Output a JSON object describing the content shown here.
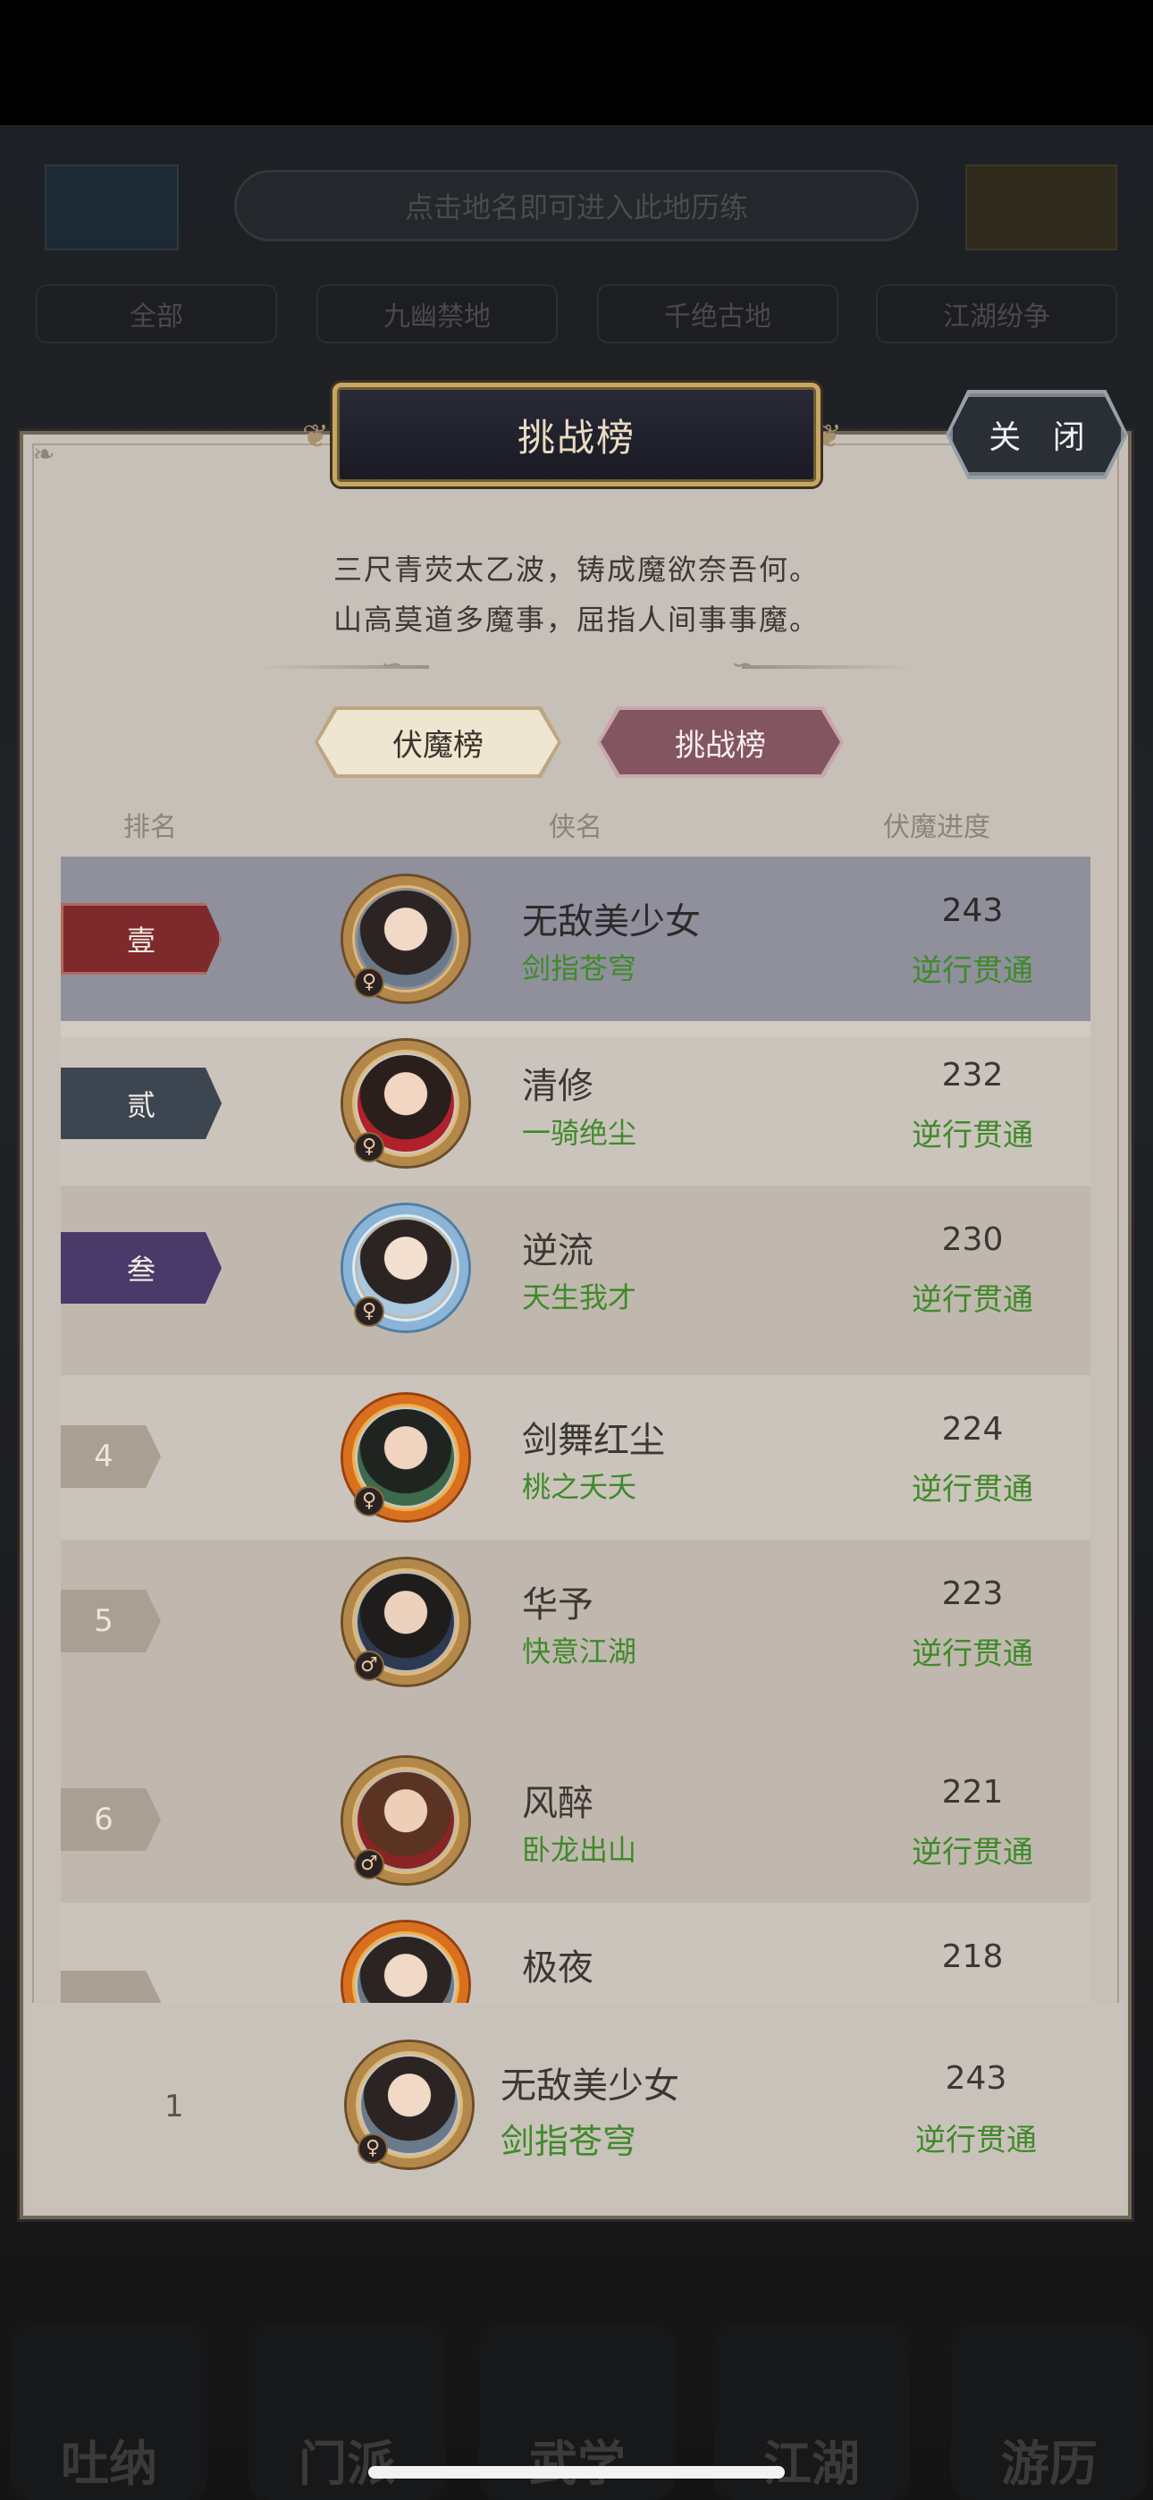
{
  "background": {
    "hint_text": "点击地名即可进入此地历练",
    "tabs": [
      "全部",
      "九幽禁地",
      "千绝古地",
      "江湖纷争"
    ],
    "nav": [
      "吐纳",
      "门派",
      "武学",
      "江湖",
      "游历"
    ]
  },
  "dialog": {
    "title": "挑战榜",
    "close_label": "关 闭",
    "poem_line1": "三尺青荧太乙波，铸成魔欲奈吾何。",
    "poem_line2": "山高莫道多魔事，屈指人间事事魔。",
    "tabs": [
      {
        "label": "伏魔榜",
        "selected": false
      },
      {
        "label": "挑战榜",
        "selected": true
      }
    ],
    "columns": {
      "rank": "排名",
      "name": "侠名",
      "progress": "伏魔进度"
    }
  },
  "rankings": [
    {
      "rank": "壹",
      "name": "无敌美少女",
      "title": "剑指苍穹",
      "score": "243",
      "stage": "逆行贯通",
      "gender": "♀"
    },
    {
      "rank": "贰",
      "name": "清修",
      "title": "一骑绝尘",
      "score": "232",
      "stage": "逆行贯通",
      "gender": "♀"
    },
    {
      "rank": "叁",
      "name": "逆流",
      "title": "天生我才",
      "score": "230",
      "stage": "逆行贯通",
      "gender": "♀"
    },
    {
      "rank": "4",
      "name": "剑舞红尘",
      "title": "桃之夭夭",
      "score": "224",
      "stage": "逆行贯通",
      "gender": "♀"
    },
    {
      "rank": "5",
      "name": "华予",
      "title": "快意江湖",
      "score": "223",
      "stage": "逆行贯通",
      "gender": "♂"
    },
    {
      "rank": "6",
      "name": "风醉",
      "title": "卧龙出山",
      "score": "221",
      "stage": "逆行贯通",
      "gender": "♂"
    },
    {
      "rank": "",
      "name": "极夜",
      "title": "",
      "score": "218",
      "stage": "",
      "gender": ""
    }
  ],
  "my_rank": {
    "rank": "1",
    "name": "无敌美少女",
    "title": "剑指苍穹",
    "score": "243",
    "stage": "逆行贯通",
    "gender": "♀"
  },
  "colors": {
    "rank1": "#7e2a2c",
    "rank2": "#3d4650",
    "rank3": "#4a3a6a",
    "title_green": "#3f8a2a",
    "selected_tab": "#835561"
  }
}
